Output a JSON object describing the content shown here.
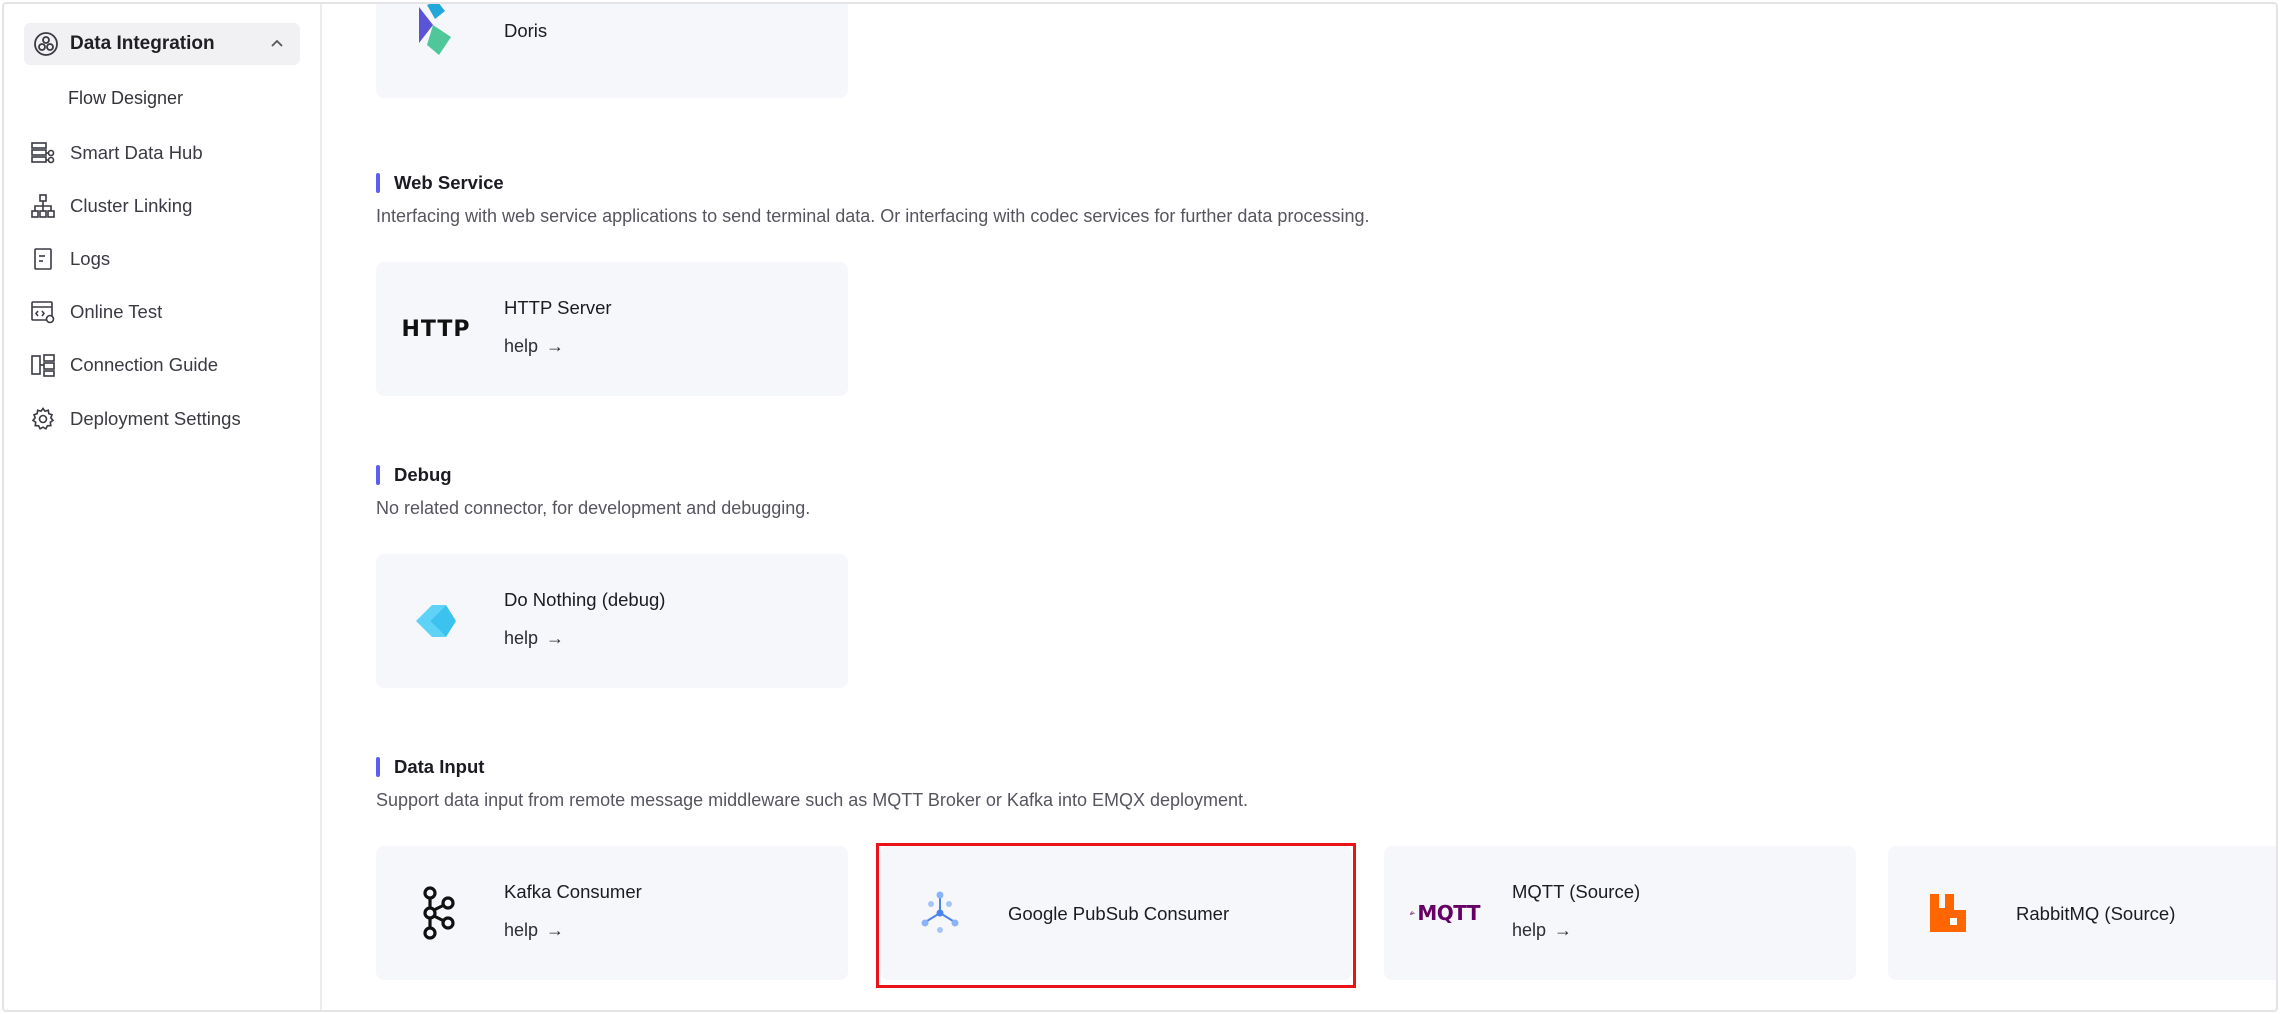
{
  "sidebar": {
    "group_label": "Data Integration",
    "sub_item": "Flow Designer",
    "items": [
      {
        "label": "Smart Data Hub",
        "icon": "data-hub-icon"
      },
      {
        "label": "Cluster Linking",
        "icon": "cluster-linking-icon"
      },
      {
        "label": "Logs",
        "icon": "logs-icon"
      },
      {
        "label": "Online Test",
        "icon": "online-test-icon"
      },
      {
        "label": "Connection Guide",
        "icon": "connection-guide-icon"
      },
      {
        "label": "Deployment Settings",
        "icon": "gear-icon"
      }
    ]
  },
  "sections": {
    "top_card": {
      "name": "Doris"
    },
    "web_service": {
      "title": "Web Service",
      "desc": "Interfacing with web service applications to send terminal data. Or interfacing with codec services for further data processing.",
      "cards": [
        {
          "name": "HTTP Server",
          "help": "help",
          "logo_text": "HTTP"
        }
      ]
    },
    "debug": {
      "title": "Debug",
      "desc": "No related connector, for development and debugging.",
      "cards": [
        {
          "name": "Do Nothing (debug)",
          "help": "help"
        }
      ]
    },
    "data_input": {
      "title": "Data Input",
      "desc": "Support data input from remote message middleware such as MQTT Broker or Kafka into EMQX deployment.",
      "cards": [
        {
          "name": "Kafka Consumer",
          "help": "help"
        },
        {
          "name": "Google PubSub Consumer"
        },
        {
          "name": "MQTT (Source)",
          "help": "help",
          "logo_text": "MQTT"
        },
        {
          "name": "RabbitMQ (Source)"
        }
      ]
    }
  },
  "help_arrow": "→",
  "colors": {
    "accent_bar": "#5b5ef0",
    "card_bg": "#f6f7fa",
    "highlight": "#e8141a",
    "rabbitmq": "#ff6600",
    "mqtt": "#660066"
  }
}
